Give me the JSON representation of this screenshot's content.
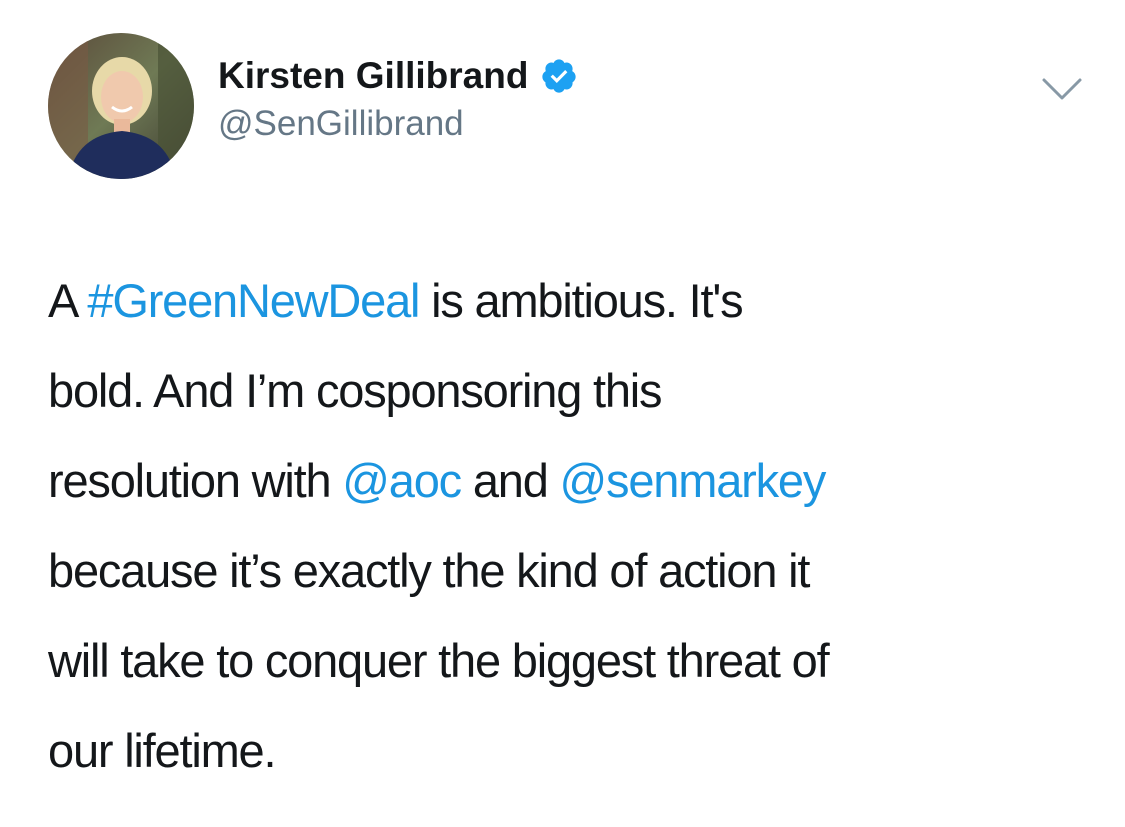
{
  "author": {
    "name": "Kirsten Gillibrand",
    "handle": "@SenGillibrand",
    "verified": true,
    "avatar_icon": "profile-photo",
    "verified_icon": "verified-badge-icon"
  },
  "menu": {
    "icon": "chevron-down-icon"
  },
  "tweet": {
    "lines": [
      [
        {
          "text": "A ",
          "type": "text"
        },
        {
          "text": "#GreenNewDeal",
          "type": "hashtag"
        },
        {
          "text": " is ambitious. It's",
          "type": "text"
        }
      ],
      [
        {
          "text": "bold. And I’m cosponsoring this",
          "type": "text"
        }
      ],
      [
        {
          "text": "resolution with ",
          "type": "text"
        },
        {
          "text": "@aoc",
          "type": "mention"
        },
        {
          "text": " and ",
          "type": "text"
        },
        {
          "text": "@senmarkey",
          "type": "mention"
        }
      ],
      [
        {
          "text": "because it’s exactly the kind of action it",
          "type": "text"
        }
      ],
      [
        {
          "text": "will take to conquer the biggest threat of",
          "type": "text"
        }
      ],
      [
        {
          "text": "our lifetime.",
          "type": "text"
        }
      ]
    ]
  },
  "colors": {
    "link": "#1b95e0",
    "text": "#14171a",
    "secondary": "#657786",
    "verified": "#1da1f2"
  }
}
